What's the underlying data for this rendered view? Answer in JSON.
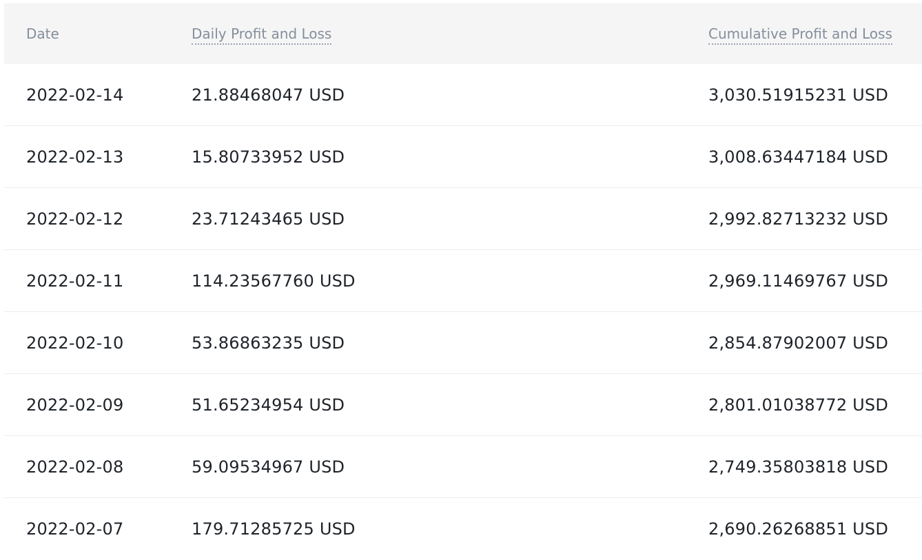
{
  "table": {
    "headers": {
      "date": "Date",
      "daily": "Daily Profit and Loss",
      "cumulative": "Cumulative Profit and Loss"
    },
    "rows": [
      {
        "date": "2022-02-14",
        "daily": "21.88468047 USD",
        "cumulative": "3,030.51915231 USD"
      },
      {
        "date": "2022-02-13",
        "daily": "15.80733952 USD",
        "cumulative": "3,008.63447184 USD"
      },
      {
        "date": "2022-02-12",
        "daily": "23.71243465 USD",
        "cumulative": "2,992.82713232 USD"
      },
      {
        "date": "2022-02-11",
        "daily": "114.23567760 USD",
        "cumulative": "2,969.11469767 USD"
      },
      {
        "date": "2022-02-10",
        "daily": "53.86863235 USD",
        "cumulative": "2,854.87902007 USD"
      },
      {
        "date": "2022-02-09",
        "daily": "51.65234954 USD",
        "cumulative": "2,801.01038772 USD"
      },
      {
        "date": "2022-02-08",
        "daily": "59.09534967 USD",
        "cumulative": "2,749.35803818 USD"
      },
      {
        "date": "2022-02-07",
        "daily": "179.71285725 USD",
        "cumulative": "2,690.26268851 USD"
      }
    ]
  }
}
